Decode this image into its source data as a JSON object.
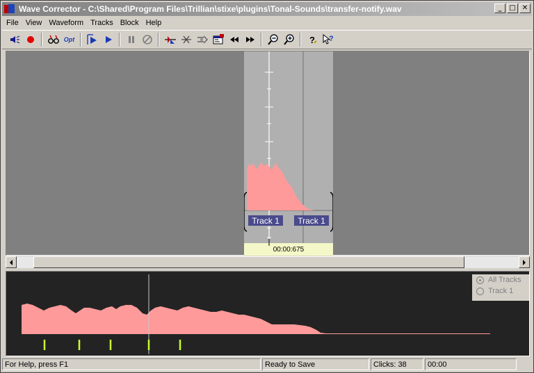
{
  "window": {
    "title": "Wave Corrector - C:\\Shared\\Program Files\\Trillian\\stixe\\plugins\\Tonal-Sounds\\transfer-notify.wav",
    "minimize": "_",
    "maximize": "□",
    "close": "✕"
  },
  "menu": [
    "File",
    "View",
    "Waveform",
    "Tracks",
    "Block",
    "Help"
  ],
  "toolbar": {
    "opt_label": "Opt",
    "icons": [
      "speaker-icon",
      "record-icon",
      "glasses-icon",
      "options-icon",
      "play-selection-icon",
      "play-icon",
      "pause-icon",
      "stop-icon",
      "split-track-icon",
      "cut-icon",
      "declick-icon",
      "properties-icon",
      "rewind-icon",
      "fast-forward-icon",
      "zoom-out-icon",
      "zoom-in-icon",
      "help-icon",
      "context-help-icon"
    ]
  },
  "wave": {
    "time_readout": "00:00:675",
    "track_labels": [
      "Track 1",
      "Track 1"
    ],
    "wave_color": "#ff9a9a",
    "panel_color": "#b0b0b0",
    "readout_bg": "#f4f8c8"
  },
  "overview": {
    "radio_all_tracks": "All Tracks",
    "radio_track1": "Track 1",
    "selected": "All Tracks",
    "marker_color": "#c8ff30"
  },
  "status": {
    "help": "For Help, press F1",
    "state": "Ready to Save",
    "clicks": "Clicks: 38",
    "time": "00:00"
  }
}
